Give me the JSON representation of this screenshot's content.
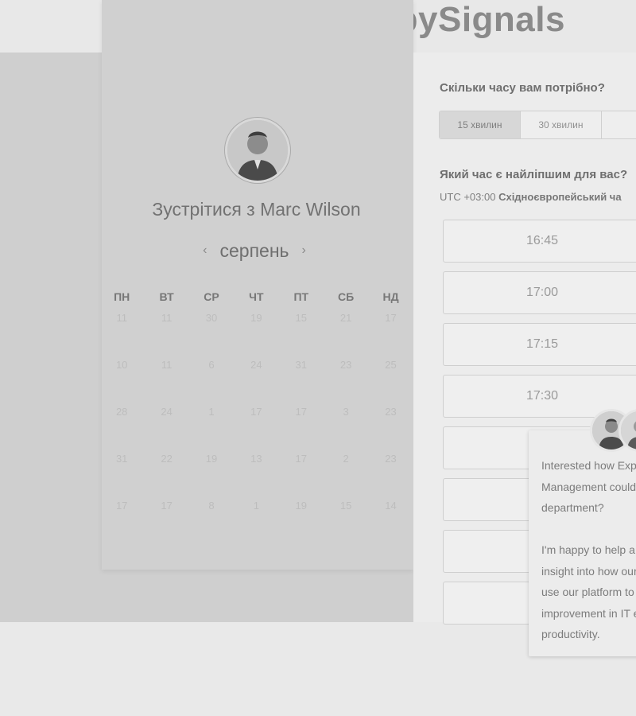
{
  "brand": {
    "name": "HappySignals"
  },
  "left": {
    "title": "Зустрітися з Marc Wilson",
    "month": "серпень",
    "nav": {
      "prev": "‹",
      "next": "›"
    },
    "weekdays": [
      "ПН",
      "ВТ",
      "СР",
      "ЧТ",
      "ПТ",
      "СБ",
      "НД"
    ],
    "days": [
      [
        "11",
        "11",
        "30",
        "19",
        "15",
        "21",
        "17"
      ],
      [
        "10",
        "11",
        "6",
        "24",
        "31",
        "23",
        "25"
      ],
      [
        "28",
        "24",
        "1",
        "17",
        "17",
        "3",
        "23"
      ],
      [
        "31",
        "22",
        "19",
        "13",
        "17",
        "2",
        "23"
      ],
      [
        "17",
        "17",
        "8",
        "1",
        "19",
        "15",
        "14"
      ]
    ]
  },
  "right": {
    "question_duration": "Скільки часу вам потрібно?",
    "durations": [
      "15 хвилин",
      "30 хвилин"
    ],
    "question_time": "Який час є найліпшим для вас?",
    "timezone_prefix": "UTC +03:00",
    "timezone_name": "Східноєвропейський ча",
    "slots": [
      "16:45",
      "17:00",
      "17:15",
      "17:30",
      "",
      "",
      "",
      ""
    ]
  },
  "chat": {
    "message": "Interested how Exp\nManagement could\ndepartment?\n\nI'm happy to help a\ninsight into how our\nuse our platform to\nimprovement in IT e\nproductivity."
  },
  "colors": {
    "background": "#e9e9e9",
    "left_panel": "#cfcfcf",
    "right_panel": "#ececec",
    "text": "#727272"
  }
}
